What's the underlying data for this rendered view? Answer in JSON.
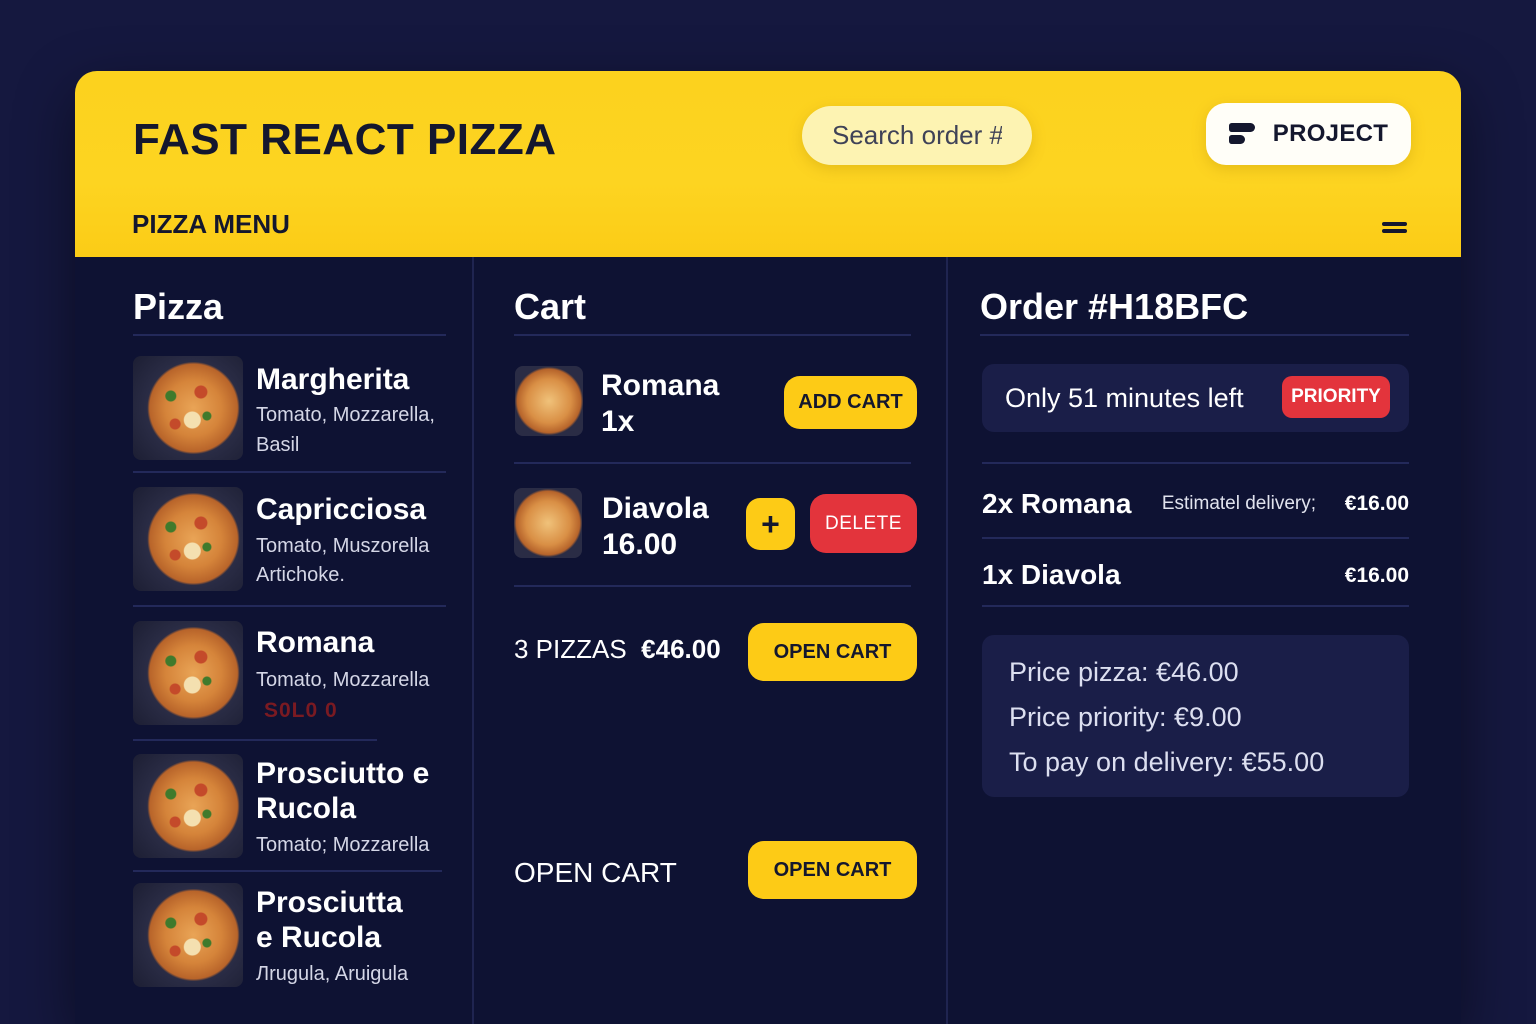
{
  "header": {
    "brand": "FAST REACT PIZZA",
    "search_placeholder": "Search order #",
    "project_label": "PROJECT",
    "menu_title": "PIZZA MENU"
  },
  "pizza_column": {
    "title": "Pizza",
    "items": [
      {
        "name": "Margherita",
        "ingredients_line1": "Tomato, Mozzarella,",
        "ingredients_line2": "Basil"
      },
      {
        "name": "Capricciosa",
        "ingredients_line1": "Tomato, Muszorella",
        "ingredients_line2": "Artichoke."
      },
      {
        "name": "Romana",
        "ingredients_line1": "Tomato, Mozzarella",
        "status": "S0L0 0"
      },
      {
        "name_line1": "Prosciutto e",
        "name_line2": "Rucola",
        "ingredients_line1": "Tomato; Mozzarella"
      },
      {
        "name_line1": "Prosciutta",
        "name_line2": "e Rucola",
        "ingredients_line1": "Лrugula, Aruigula"
      }
    ]
  },
  "cart_column": {
    "title": "Cart",
    "items": [
      {
        "name": "Romana",
        "detail": "1x",
        "button": "ADD CART"
      },
      {
        "name": "Diavola",
        "detail": "16.00",
        "plus_button": "+",
        "button": "DELETE"
      }
    ],
    "summary_count": "3 PIZZAS",
    "summary_price": "€46.00",
    "open_cart_button": "OPEN CART",
    "open_cart_text": "OPEN CART",
    "open_cart_button_2": "OPEN CART"
  },
  "order_column": {
    "title": "Order #H18BFC",
    "countdown": "Only 51 minutes left",
    "priority_badge": "PRIORITY",
    "items": [
      {
        "name": "2x Romana",
        "estimate": "Estimatel delivery;",
        "price": "€16.00"
      },
      {
        "name": "1x Diavola",
        "price": "€16.00"
      }
    ],
    "price_pizza": "Price pizza: €46.00",
    "price_priority": "Price priority: €9.00",
    "to_pay": "To pay on delivery: €55.00"
  },
  "colors": {
    "background": "#15183f",
    "panel": "#0e1233",
    "accent_yellow": "#fdcb16",
    "danger_red": "#e3343c"
  }
}
